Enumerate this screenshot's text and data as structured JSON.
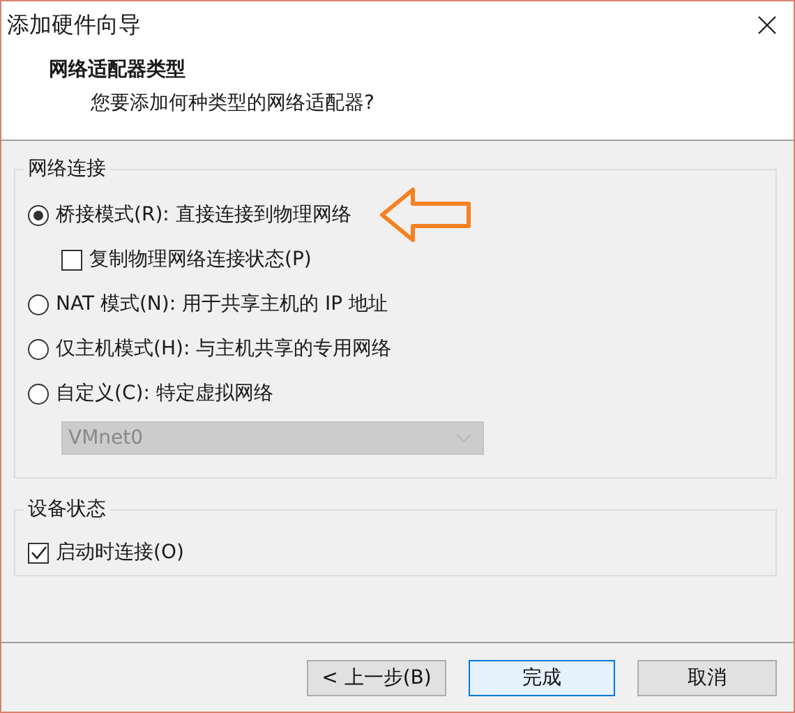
{
  "window": {
    "title": "添加硬件向导"
  },
  "header": {
    "title": "网络适配器类型",
    "subtitle": "您要添加何种类型的网络适配器?"
  },
  "network_connection": {
    "label": "网络连接",
    "options": [
      {
        "kind": "radio",
        "label": "桥接模式(R): 直接连接到物理网络",
        "selected": true
      },
      {
        "kind": "checkbox",
        "label": "复制物理网络连接状态(P)",
        "checked": false
      },
      {
        "kind": "radio",
        "label": "NAT 模式(N): 用于共享主机的 IP 地址",
        "selected": false
      },
      {
        "kind": "radio",
        "label": "仅主机模式(H): 与主机共享的专用网络",
        "selected": false
      },
      {
        "kind": "radio",
        "label": "自定义(C): 特定虚拟网络",
        "selected": false
      }
    ],
    "dropdown": {
      "value": "VMnet0",
      "disabled": true
    }
  },
  "device_status": {
    "label": "设备状态",
    "options": [
      {
        "label": "启动时连接(O)",
        "checked": true
      }
    ]
  },
  "buttons": [
    {
      "label": "< 上一步(B)",
      "default": false
    },
    {
      "label": "完成",
      "default": true
    },
    {
      "label": "取消",
      "default": false
    }
  ]
}
